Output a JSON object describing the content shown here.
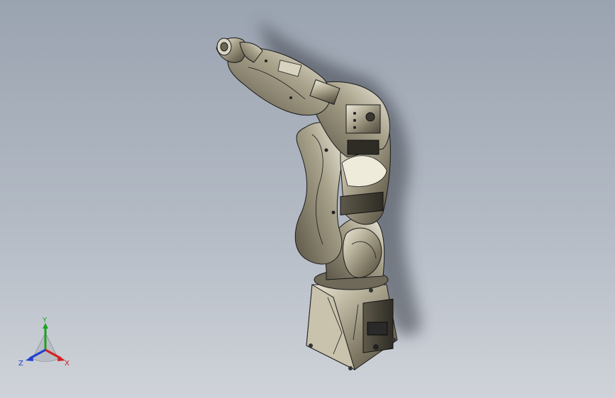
{
  "viewport": {
    "background_top": "#9aa3b0",
    "background_bottom": "#cfd3d9"
  },
  "model": {
    "body_color": "#8a8470",
    "highlight_color": "#e6e2d2",
    "edge_color": "#1a1a1a",
    "shadow_color": "#3a3f48"
  },
  "triad": {
    "x_label": "X",
    "y_label": "Y",
    "z_label": "Z",
    "x_color": "#d32020",
    "y_color": "#1fa11f",
    "z_color": "#1f3fd0"
  }
}
